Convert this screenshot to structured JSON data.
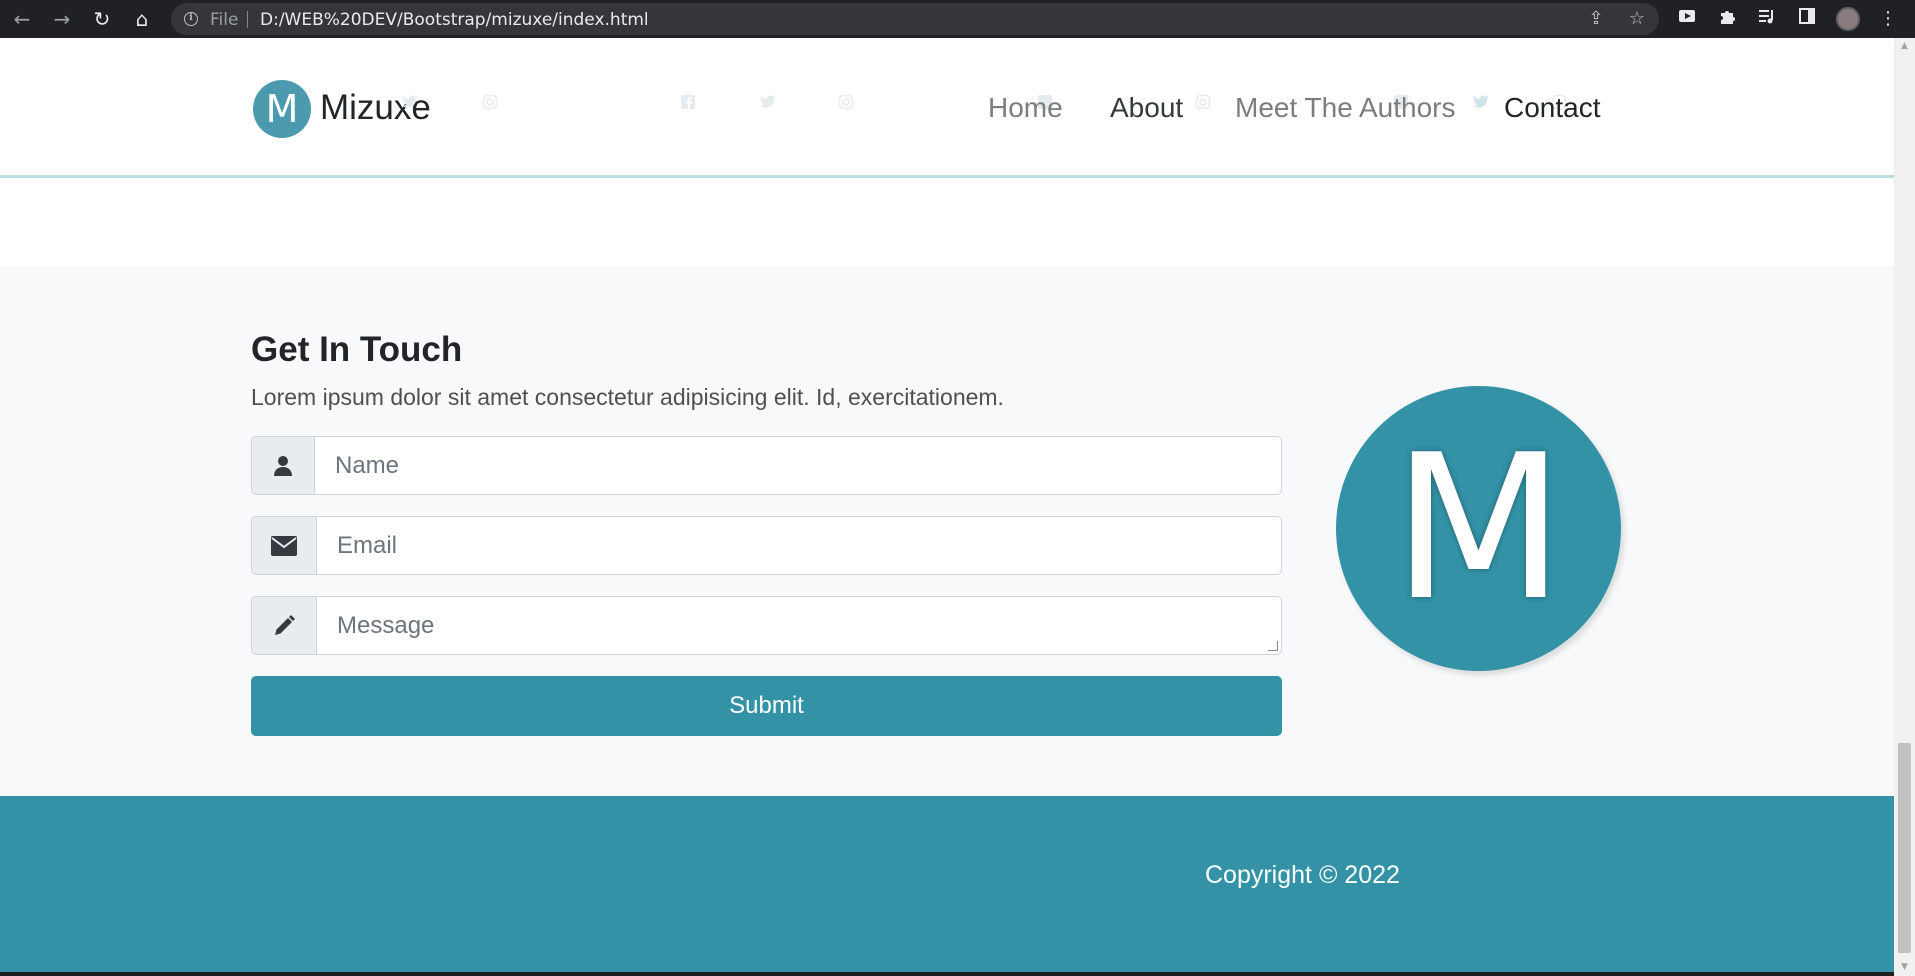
{
  "browser": {
    "back_glyph": "←",
    "forward_glyph": "→",
    "reload_glyph": "↻",
    "home_glyph": "⌂",
    "file_label": "File",
    "url": "D:/WEB%20DEV/Bootstrap/mizuxe/index.html",
    "share_glyph": "⇪",
    "star_glyph": "☆",
    "menu_glyph": "⋮",
    "accent": "#202124"
  },
  "header": {
    "logo_letter": "M",
    "brand": "Mizuxe",
    "nav": {
      "home": "Home",
      "about": "About",
      "authors": "Meet The Authors",
      "contact": "Contact"
    }
  },
  "contact": {
    "title": "Get In Touch",
    "description": "Lorem ipsum dolor sit amet consectetur adipisicing elit. Id, exercitationem.",
    "name_placeholder": "Name",
    "email_placeholder": "Email",
    "message_placeholder": "Message",
    "submit": "Submit",
    "logo_letter": "M",
    "accent": "#3492a6"
  },
  "footer": {
    "copyright": "Copyright © 2022"
  }
}
